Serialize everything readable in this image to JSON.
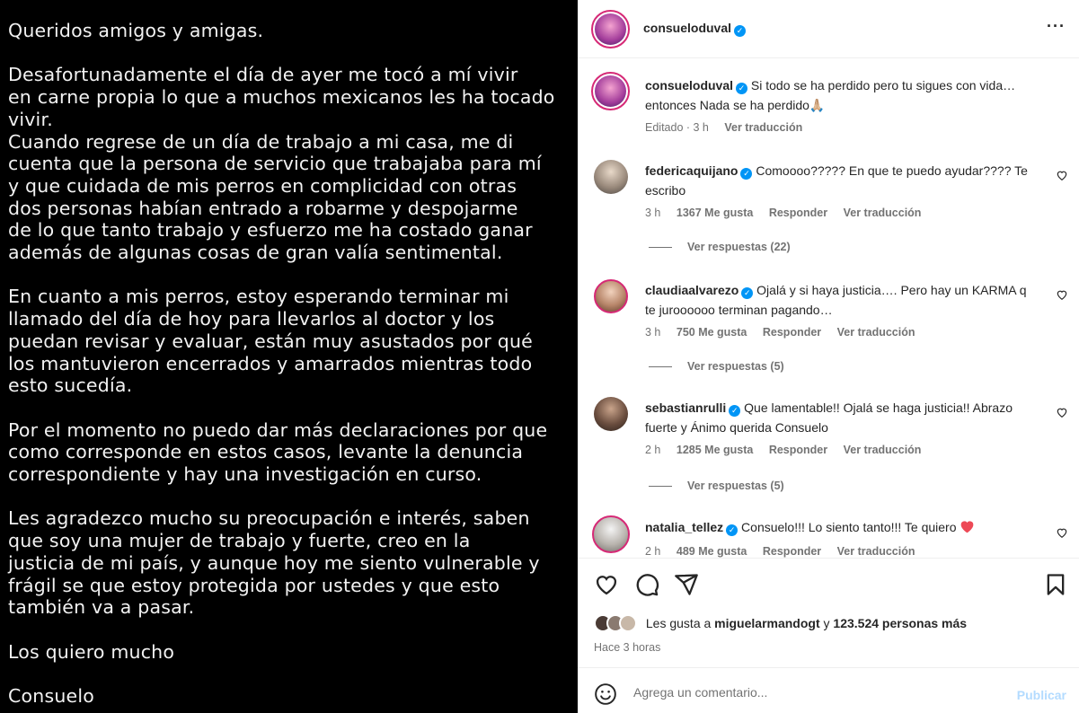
{
  "post_image": {
    "paragraphs": [
      "Queridos amigos y amigas.",
      "Desafortunadamente el día de ayer me tocó a mí vivir\nen carne propia lo que a muchos mexicanos les ha tocado\nvivir.\nCuando regrese de un día de trabajo a mi casa, me di\ncuenta que la persona de servicio que trabajaba para mí\ny que cuidada de mis perros en complicidad con otras\ndos personas habían entrado a robarme y despojarme\nde lo que tanto trabajo y esfuerzo me ha costado ganar\nademás de algunas cosas de gran valía sentimental.",
      "En cuanto a mis perros, estoy esperando terminar mi\nllamado del día de hoy para llevarlos al doctor y los\npuedan revisar y evaluar, están muy asustados por qué\nlos mantuvieron encerrados y amarrados mientras todo\nesto sucedía.",
      "Por el momento no puedo dar más declaraciones por que\ncomo corresponde en estos casos, levante la denuncia\ncorrespondiente y hay una investigación en curso.",
      "Les agradezco mucho su preocupación e interés, saben\nque soy una mujer de trabajo y fuerte, creo en la\njusticia de mi país, y aunque hoy me siento vulnerable y\nfrágil se que estoy protegida por ustedes y que esto\ntambién va a pasar.",
      "Los quiero mucho",
      "Consuelo"
    ]
  },
  "header": {
    "username": "consueloduval"
  },
  "caption": {
    "username": "consueloduval",
    "text": "Si todo se ha perdido pero tu sigues con vida… entonces Nada se ha perdido🙏🏼",
    "edited": "Editado · 3 h",
    "translate": "Ver traducción"
  },
  "comments": [
    {
      "username": "federicaquijano",
      "text": "Comoooo????? En que te puedo ayudar???? Te escribo",
      "time": "3 h",
      "likes": "1367 Me gusta",
      "reply": "Responder",
      "translate": "Ver traducción",
      "replies": "Ver respuestas (22)"
    },
    {
      "username": "claudiaalvarezo",
      "text": "Ojalá y si haya justicia…. Pero hay un KARMA q te juroooooo terminan pagando…",
      "time": "3 h",
      "likes": "750 Me gusta",
      "reply": "Responder",
      "translate": "Ver traducción",
      "replies": "Ver respuestas (5)"
    },
    {
      "username": "sebastianrulli",
      "text": "Que lamentable!! Ojalá se haga justicia!! Abrazo fuerte y Ánimo querida Consuelo",
      "time": "2 h",
      "likes": "1285 Me gusta",
      "reply": "Responder",
      "translate": "Ver traducción",
      "replies": "Ver respuestas (5)"
    },
    {
      "username": "natalia_tellez",
      "text": "Consuelo!!! Lo siento tanto!!! Te quiero",
      "time": "2 h",
      "likes": "489 Me gusta",
      "reply": "Responder",
      "translate": "Ver traducción"
    }
  ],
  "likes": {
    "prefix": "Les gusta a",
    "user": "miguelarmandogt",
    "middle": "y",
    "count": "123.524 personas más"
  },
  "time_ago": "Hace 3 horas",
  "add_comment": {
    "placeholder": "Agrega un comentario...",
    "publish": "Publicar"
  },
  "colors": {
    "verified": "#0095f6",
    "heart_red": "#ed4956",
    "publish": "#b3dbff"
  }
}
